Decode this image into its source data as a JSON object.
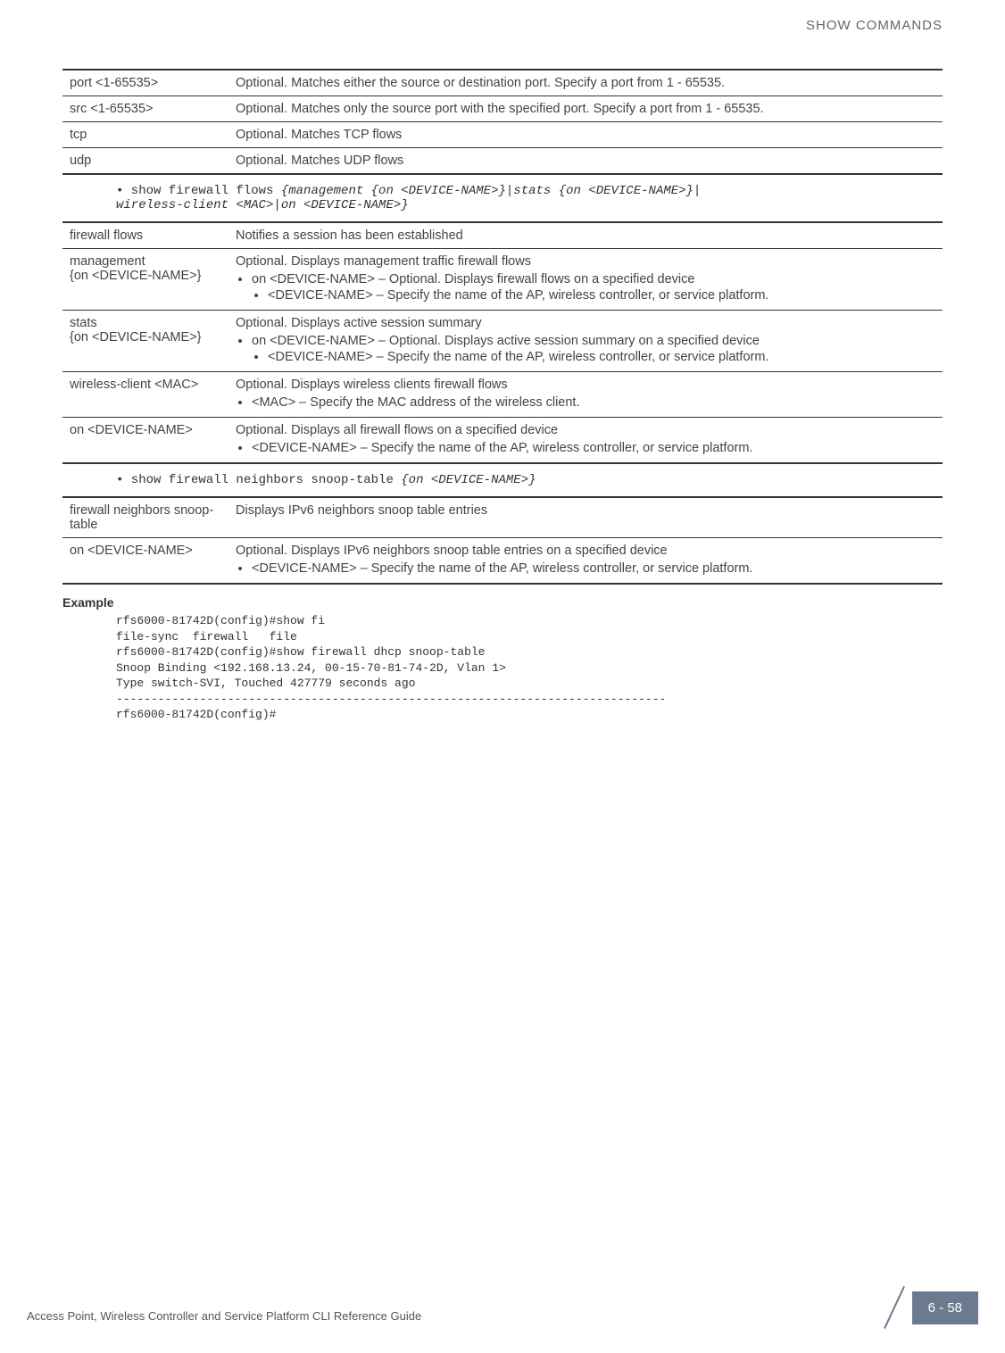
{
  "header": {
    "right_text": "SHOW COMMANDS"
  },
  "table1": {
    "rows": [
      {
        "left": "port <1-65535>",
        "right": "Optional. Matches either the source or destination port. Specify a port from 1 - 65535."
      },
      {
        "left": "src <1-65535>",
        "right": "Optional. Matches only the source port with the specified port. Specify a port from 1 - 65535."
      },
      {
        "left": "tcp",
        "right": "Optional. Matches TCP flows"
      },
      {
        "left": "udp",
        "right": "Optional. Matches UDP flows"
      }
    ]
  },
  "command1": {
    "prefix": "• show firewall flows ",
    "italic": "{management {on <DEVICE-NAME>}|stats {on <DEVICE-NAME>}|\nwireless-client <MAC>|on <DEVICE-NAME>}"
  },
  "table2": {
    "row1": {
      "left": "firewall flows",
      "right": "Notifies a session has been established"
    },
    "row2": {
      "left": "management\n{on <DEVICE-NAME>}",
      "right_top": "Optional. Displays management traffic firewall flows",
      "bullet1": "on <DEVICE-NAME> – Optional. Displays firewall flows on a specified device",
      "sub1": "<DEVICE-NAME> – Specify the name of the AP, wireless controller, or service platform."
    },
    "row3": {
      "left": "stats\n{on <DEVICE-NAME>}",
      "right_top": "Optional. Displays active session summary",
      "bullet1": "on <DEVICE-NAME> – Optional. Displays active session summary on a specified device",
      "sub1": "<DEVICE-NAME> – Specify the name of the AP, wireless controller, or service platform."
    },
    "row4": {
      "left": "wireless-client <MAC>",
      "right_top": "Optional. Displays wireless clients firewall flows",
      "bullet1": "<MAC> – Specify the MAC address of the wireless client."
    },
    "row5": {
      "left": "on <DEVICE-NAME>",
      "right_top": "Optional. Displays all firewall flows on a specified device",
      "bullet1": "<DEVICE-NAME> – Specify the name of the AP, wireless controller, or service platform."
    }
  },
  "command2": {
    "prefix": "• show firewall neighbors snoop-table ",
    "italic": "{on <DEVICE-NAME>}"
  },
  "table3": {
    "row1": {
      "left": "firewall neighbors snoop-table",
      "right": "Displays IPv6 neighbors snoop table entries"
    },
    "row2": {
      "left": "on <DEVICE-NAME>",
      "right_top": "Optional. Displays IPv6 neighbors snoop table entries on a specified device",
      "bullet1": "<DEVICE-NAME> – Specify the name of the AP, wireless controller, or service platform."
    }
  },
  "example": {
    "heading": "Example",
    "code": "rfs6000-81742D(config)#show fi\nfile-sync  firewall   file\nrfs6000-81742D(config)#show firewall dhcp snoop-table\nSnoop Binding <192.168.13.24, 00-15-70-81-74-2D, Vlan 1>\nType switch-SVI, Touched 427779 seconds ago\n-------------------------------------------------------------------------------\nrfs6000-81742D(config)#"
  },
  "footer": {
    "text": "Access Point, Wireless Controller and Service Platform CLI Reference Guide",
    "page": "6 - 58"
  }
}
